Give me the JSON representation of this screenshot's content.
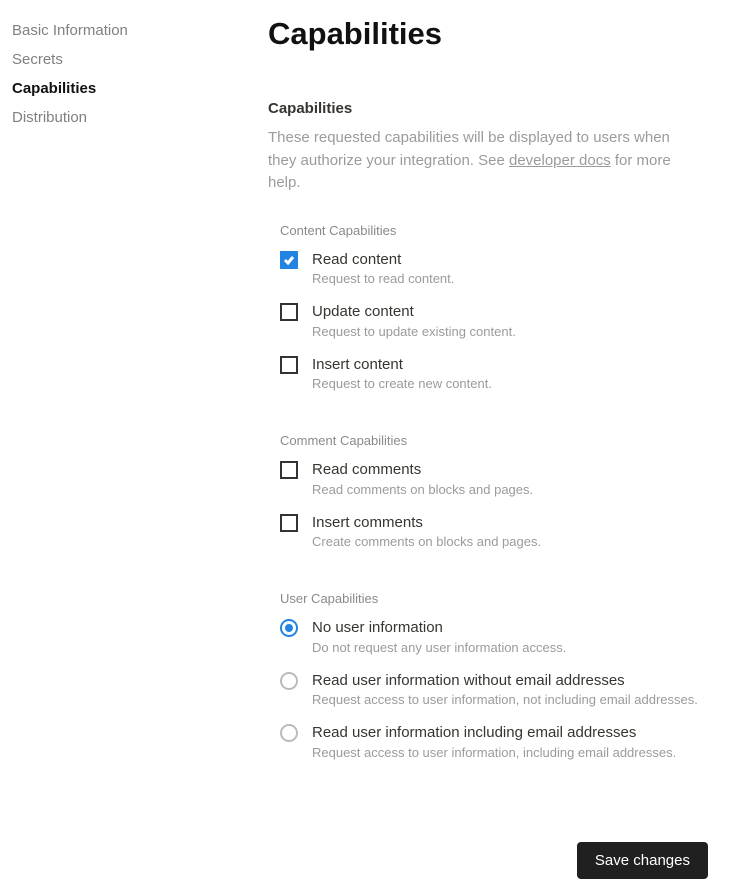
{
  "sidebar": {
    "items": [
      {
        "label": "Basic Information",
        "active": false
      },
      {
        "label": "Secrets",
        "active": false
      },
      {
        "label": "Capabilities",
        "active": true
      },
      {
        "label": "Distribution",
        "active": false
      }
    ]
  },
  "page": {
    "title": "Capabilities"
  },
  "section": {
    "heading": "Capabilities",
    "description_pre": "These requested capabilities will be displayed to users when they authorize your integration. See ",
    "description_link": "developer docs",
    "description_post": " for more help."
  },
  "groups": {
    "content": {
      "title": "Content Capabilities",
      "options": [
        {
          "label": "Read content",
          "desc": "Request to read content.",
          "checked": true
        },
        {
          "label": "Update content",
          "desc": "Request to update existing content.",
          "checked": false
        },
        {
          "label": "Insert content",
          "desc": "Request to create new content.",
          "checked": false
        }
      ]
    },
    "comment": {
      "title": "Comment Capabilities",
      "options": [
        {
          "label": "Read comments",
          "desc": "Read comments on blocks and pages.",
          "checked": false
        },
        {
          "label": "Insert comments",
          "desc": "Create comments on blocks and pages.",
          "checked": false
        }
      ]
    },
    "user": {
      "title": "User Capabilities",
      "options": [
        {
          "label": "No user information",
          "desc": "Do not request any user information access.",
          "selected": true
        },
        {
          "label": "Read user information without email addresses",
          "desc": "Request access to user information, not including email addresses.",
          "selected": false
        },
        {
          "label": "Read user information including email addresses",
          "desc": "Request access to user information, including email addresses.",
          "selected": false
        }
      ]
    }
  },
  "footer": {
    "save_label": "Save changes"
  }
}
